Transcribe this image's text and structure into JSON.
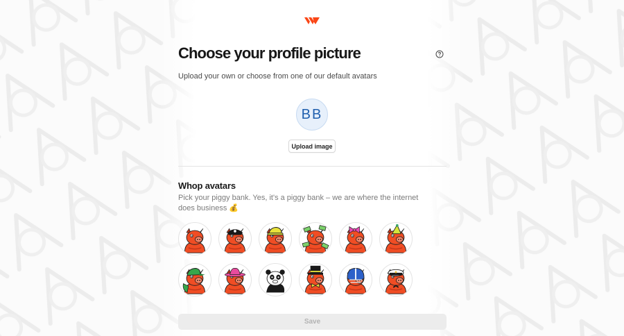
{
  "brand": {
    "logo_icon": "whop-logo-icon",
    "accent": "#fa4616"
  },
  "header": {
    "title": "Choose your profile picture",
    "help_icon": "question-circle-icon"
  },
  "upload": {
    "subtitle": "Upload your own or choose from one of our default avatars",
    "initials": "BB",
    "button_label": "Upload image"
  },
  "avatars_section": {
    "title": "Whop avatars",
    "description": "Pick your piggy bank. Yes, it's a piggy bank – we are where the internet does business 💰",
    "items": [
      {
        "name": "plain",
        "accessory": "none"
      },
      {
        "name": "pirate",
        "accessory": "pirate-hat"
      },
      {
        "name": "construction",
        "accessory": "hard-hat"
      },
      {
        "name": "money",
        "accessory": "cash-bills"
      },
      {
        "name": "bow",
        "accessory": "pink-bow"
      },
      {
        "name": "party",
        "accessory": "party-hat"
      },
      {
        "name": "cap",
        "accessory": "green-cap"
      },
      {
        "name": "cowboy",
        "accessory": "pink-cowboy-hat"
      },
      {
        "name": "panda",
        "accessory": "panda"
      },
      {
        "name": "tophat",
        "accessory": "top-hat-bowtie"
      },
      {
        "name": "football",
        "accessory": "football-helmet"
      },
      {
        "name": "captain",
        "accessory": "captain-hat"
      }
    ]
  },
  "footer": {
    "save_label": "Save"
  },
  "colors": {
    "pig_body": "#f04d24",
    "pig_dark": "#c2361a",
    "initials_bg": "#e7f0fb",
    "initials_text": "#1f5fae",
    "save_disabled_bg": "#ececec"
  }
}
